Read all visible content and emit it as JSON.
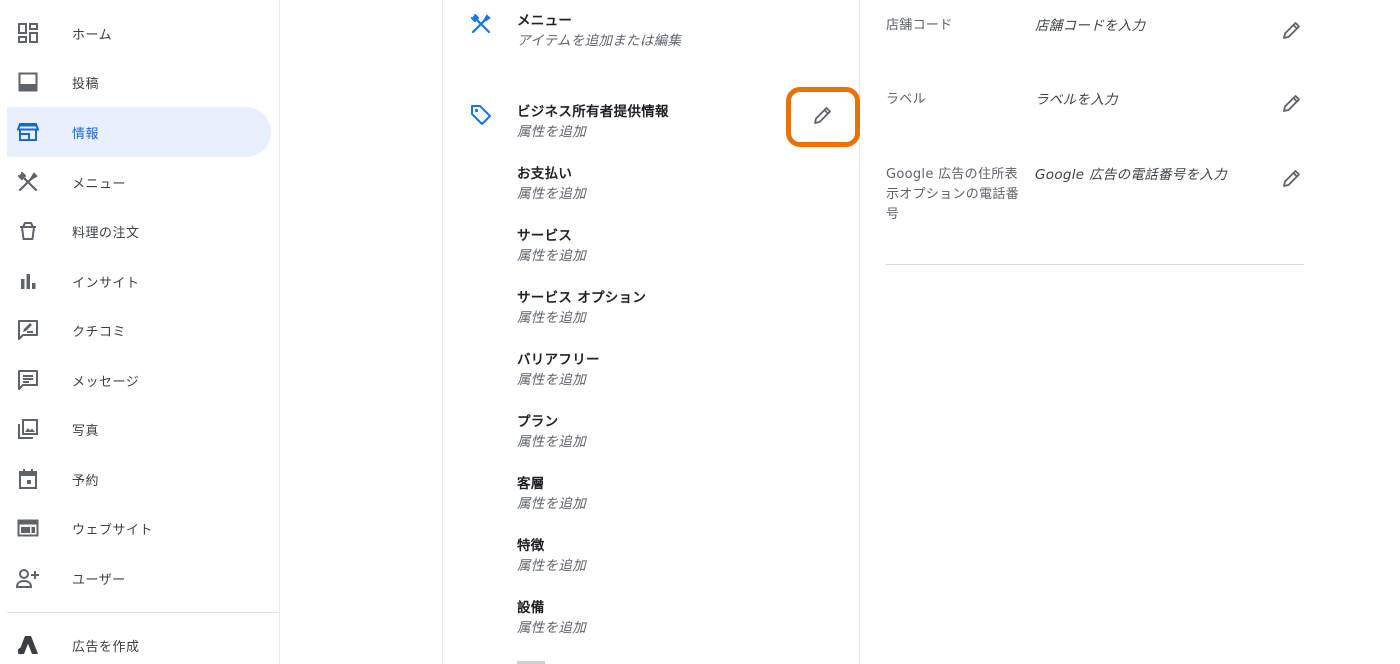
{
  "sidebar": {
    "items": [
      {
        "label": "ホーム",
        "icon": "dashboard-icon"
      },
      {
        "label": "投稿",
        "icon": "post-icon"
      },
      {
        "label": "情報",
        "icon": "storefront-icon",
        "active": true
      },
      {
        "label": "メニュー",
        "icon": "restaurant-icon"
      },
      {
        "label": "料理の注文",
        "icon": "takeout-icon"
      },
      {
        "label": "インサイト",
        "icon": "bar-chart-icon"
      },
      {
        "label": "クチコミ",
        "icon": "rate-review-icon"
      },
      {
        "label": "メッセージ",
        "icon": "message-icon"
      },
      {
        "label": "写真",
        "icon": "photo-library-icon"
      },
      {
        "label": "予約",
        "icon": "calendar-icon"
      },
      {
        "label": "ウェブサイト",
        "icon": "web-icon"
      },
      {
        "label": "ユーザー",
        "icon": "person-add-icon"
      },
      {
        "label": "広告を作成",
        "icon": "google-ads-icon"
      }
    ]
  },
  "content": {
    "menu": {
      "title": "メニュー",
      "subtitle": "アイテムを追加または編集"
    },
    "attributes_header": {
      "title": "ビジネス所有者提供情報",
      "subtitle": "属性を追加"
    },
    "attributes": [
      {
        "title": "お支払い",
        "subtitle": "属性を追加"
      },
      {
        "title": "サービス",
        "subtitle": "属性を追加"
      },
      {
        "title": "サービス オプション",
        "subtitle": "属性を追加"
      },
      {
        "title": "バリアフリー",
        "subtitle": "属性を追加"
      },
      {
        "title": "プラン",
        "subtitle": "属性を追加"
      },
      {
        "title": "客層",
        "subtitle": "属性を追加"
      },
      {
        "title": "特徴",
        "subtitle": "属性を追加"
      },
      {
        "title": "設備",
        "subtitle": "属性を追加"
      }
    ]
  },
  "details": {
    "rows": [
      {
        "label": "店舗コード",
        "value": "店舗コードを入力"
      },
      {
        "label": "ラベル",
        "value": "ラベルを入力"
      },
      {
        "label": "Google 広告の住所表示オプションの電話番号",
        "value": "Google 広告の電話番号を入力"
      }
    ]
  },
  "colors": {
    "accent": "#1a73e8",
    "active_bg": "#e8f0fe",
    "highlight": "#e8710a",
    "icon_gray": "#5f6368"
  }
}
